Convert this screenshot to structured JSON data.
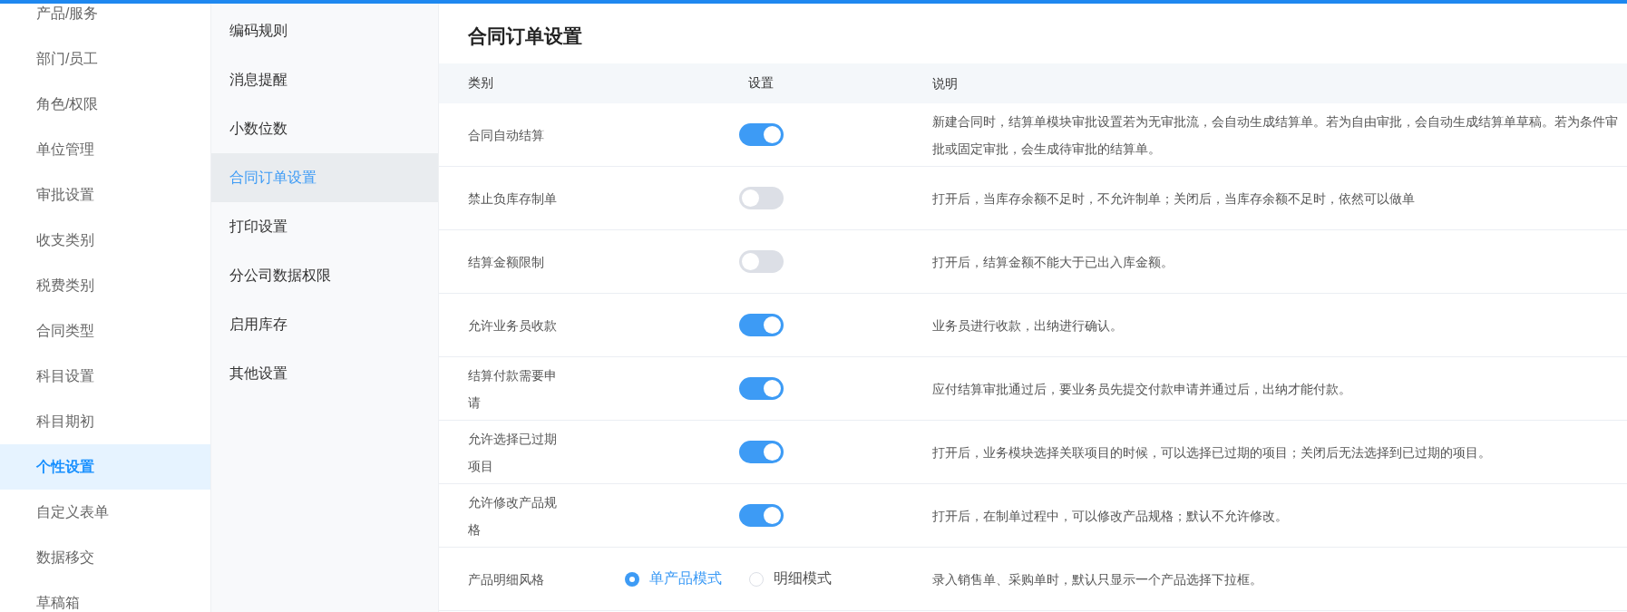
{
  "sidebar": {
    "items": [
      {
        "label": "产品/服务",
        "selected": false
      },
      {
        "label": "部门/员工",
        "selected": false
      },
      {
        "label": "角色/权限",
        "selected": false
      },
      {
        "label": "单位管理",
        "selected": false
      },
      {
        "label": "审批设置",
        "selected": false
      },
      {
        "label": "收支类别",
        "selected": false
      },
      {
        "label": "税费类别",
        "selected": false
      },
      {
        "label": "合同类型",
        "selected": false
      },
      {
        "label": "科目设置",
        "selected": false
      },
      {
        "label": "科目期初",
        "selected": false
      },
      {
        "label": "个性设置",
        "selected": true
      },
      {
        "label": "自定义表单",
        "selected": false
      },
      {
        "label": "数据移交",
        "selected": false
      },
      {
        "label": "草稿箱",
        "selected": false
      }
    ]
  },
  "submenu": {
    "items": [
      {
        "label": "编码规则",
        "selected": false
      },
      {
        "label": "消息提醒",
        "selected": false
      },
      {
        "label": "小数位数",
        "selected": false
      },
      {
        "label": "合同订单设置",
        "selected": true
      },
      {
        "label": "打印设置",
        "selected": false
      },
      {
        "label": "分公司数据权限",
        "selected": false
      },
      {
        "label": "启用库存",
        "selected": false
      },
      {
        "label": "其他设置",
        "selected": false
      }
    ]
  },
  "page": {
    "title": "合同订单设置"
  },
  "table": {
    "columns": [
      "类别",
      "设置",
      "说明"
    ],
    "rows": [
      {
        "kind": "switch",
        "category": "合同自动结算",
        "on": true,
        "description": "新建合同时，结算单模块审批设置若为无审批流，会自动生成结算单。若为自由审批，会自动生成结算单草稿。若为条件审批或固定审批，会生成待审批的结算单。"
      },
      {
        "kind": "switch",
        "category": "禁止负库存制单",
        "on": false,
        "description": "打开后，当库存余额不足时，不允许制单；关闭后，当库存余额不足时，依然可以做单"
      },
      {
        "kind": "switch",
        "category": "结算金额限制",
        "on": false,
        "description": "打开后，结算金额不能大于已出入库金额。"
      },
      {
        "kind": "switch",
        "category": "允许业务员收款",
        "on": true,
        "description": "业务员进行收款，出纳进行确认。"
      },
      {
        "kind": "switch",
        "category": "结算付款需要申请",
        "on": true,
        "description": "应付结算审批通过后，要业务员先提交付款申请并通过后，出纳才能付款。"
      },
      {
        "kind": "switch",
        "category": "允许选择已过期项目",
        "on": true,
        "description": "打开后，业务模块选择关联项目的时候，可以选择已过期的项目；关闭后无法选择到已过期的项目。"
      },
      {
        "kind": "switch",
        "category": "允许修改产品规格",
        "on": true,
        "description": "打开后，在制单过程中，可以修改产品规格；默认不允许修改。"
      },
      {
        "kind": "radio",
        "category": "产品明细风格",
        "options": [
          {
            "label": "单产品模式",
            "selected": true
          },
          {
            "label": "明细模式",
            "selected": false
          }
        ],
        "description": "录入销售单、采购单时，默认只显示一个产品选择下拉框。"
      }
    ]
  }
}
